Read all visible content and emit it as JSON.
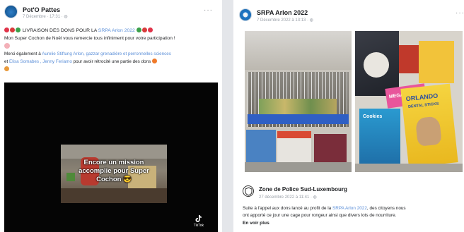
{
  "left_post": {
    "page_name": "Pot'O Pattes",
    "timestamp": "7 Décembre · 17:31 · ",
    "more": "···",
    "line1_prefix": "LIVRAISON DES DONS POUR LA ",
    "line1_link": "SRPA Arlon 2022",
    "line2": "Mon Super Cochon de Noël vous remercie tous infiniment pour votre participation !",
    "line3_prefix": "Merci également à ",
    "line3_link": "Aurelie Stiftung Arlon, gazzar grenadière et perronnelles sciences",
    "line4_prefix": "et ",
    "line4_link": "Elisa Somabes , Jenny Feriamo",
    "line4_suffix": " pour avoir rétrocité une partie des dons",
    "video_caption": "Encore un mission\naccomplie pour Super\nCochon 😎",
    "tiktok_label": "TikTok"
  },
  "right_post": {
    "page_name": "SRPA Arlon 2022",
    "timestamp": "7 Décembre 2022 à 13:13 · ",
    "more": "···",
    "shared_page_name": "Zone de Police Sud-Luxembourg",
    "shared_timestamp": "27 décembre 2022 à 11:41 · ",
    "body_line1_prefix": "Suite à l'appel aux dons lancé au profit de la ",
    "body_link": "SRPA Arlon 2022",
    "body_line1_suffix": ", des citoyens nous",
    "body_line2": "ont apporté ce jour une cage pour rongeur ainsi que divers lots de nourriture.",
    "see_more": "En voir plus",
    "product_text_megapack": "MEGA PACK",
    "product_text_orlando": "ORLANDO",
    "product_text_dental": "DENTAL STICKS",
    "product_text_cookies": "Cookies"
  },
  "colors": {
    "link": "#5b8fd8",
    "background": "#e4e6ea",
    "card": "#ffffff"
  },
  "icons": [
    "globe-icon",
    "more-icon",
    "heart-emoji-icon",
    "tiktok-icon",
    "police-logo-icon"
  ]
}
